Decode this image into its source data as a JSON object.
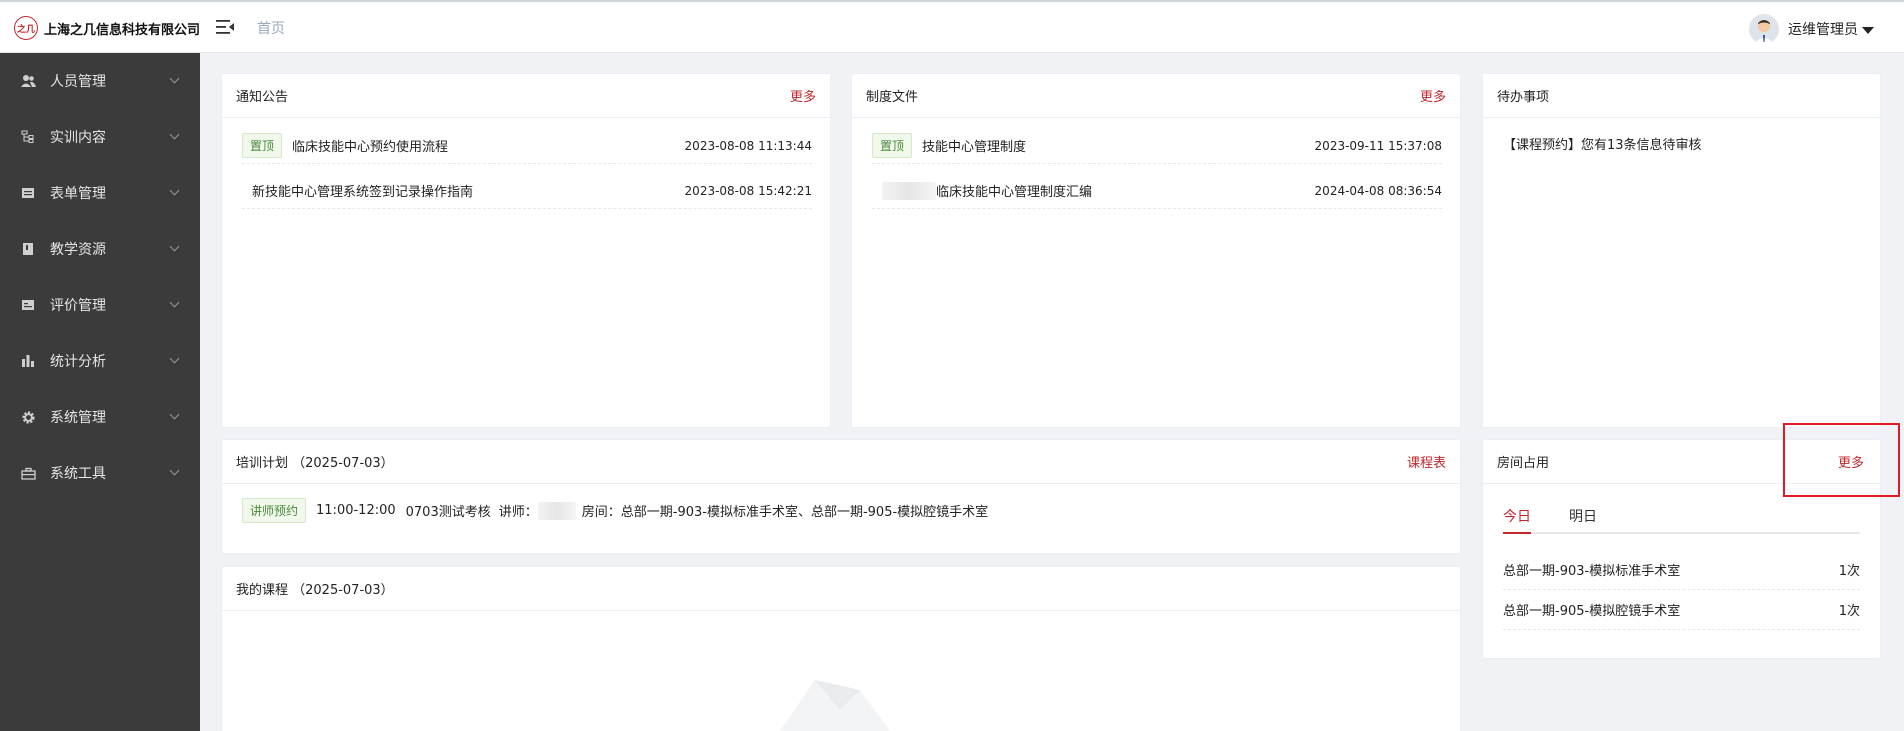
{
  "header": {
    "logo_text": "之几",
    "company": "上海之几信息科技有限公司",
    "breadcrumb": "首页",
    "username": "运维管理员"
  },
  "sidebar": {
    "items": [
      {
        "label": "人员管理",
        "icon": "users-icon"
      },
      {
        "label": "实训内容",
        "icon": "tree-icon"
      },
      {
        "label": "表单管理",
        "icon": "form-icon"
      },
      {
        "label": "教学资源",
        "icon": "book-icon"
      },
      {
        "label": "评价管理",
        "icon": "rating-icon"
      },
      {
        "label": "统计分析",
        "icon": "bar-chart-icon"
      },
      {
        "label": "系统管理",
        "icon": "gear-icon"
      },
      {
        "label": "系统工具",
        "icon": "toolbox-icon"
      }
    ]
  },
  "notice": {
    "title": "通知公告",
    "more": "更多",
    "items": [
      {
        "tag": "置顶",
        "text": "临床技能中心预约使用流程",
        "date": "2023-08-08 11:13:44"
      },
      {
        "tag": "",
        "text": "新技能中心管理系统签到记录操作指南",
        "date": "2023-08-08 15:42:21"
      }
    ]
  },
  "policy": {
    "title": "制度文件",
    "more": "更多",
    "items": [
      {
        "tag": "置顶",
        "text": "技能中心管理制度",
        "date": "2023-09-11 15:37:08"
      },
      {
        "tag": "",
        "text": "临床技能中心管理制度汇编",
        "date": "2024-04-08 08:36:54"
      }
    ]
  },
  "todo": {
    "title": "待办事项",
    "item": "【课程预约】您有13条信息待审核"
  },
  "training": {
    "title": "培训计划 （2025-07-03）",
    "link": "课程表",
    "tag": "讲师预约",
    "time": "11:00-12:00",
    "course": "0703测试考核",
    "lecturer_label": "讲师：",
    "room_label": "房间：",
    "rooms": "总部一期-903-模拟标准手术室、总部一期-905-模拟腔镜手术室"
  },
  "my_course": {
    "title": "我的课程 （2025-07-03）"
  },
  "room": {
    "title": "房间占用",
    "more": "更多",
    "tabs": [
      "今日",
      "明日"
    ],
    "items": [
      {
        "name": "总部一期-903-模拟标准手术室",
        "count": "1次"
      },
      {
        "name": "总部一期-905-模拟腔镜手术室",
        "count": "1次"
      }
    ]
  },
  "colors": {
    "accent": "#c1272d",
    "sidebar": "#3b3b3b",
    "highlight": "#e01b24"
  }
}
